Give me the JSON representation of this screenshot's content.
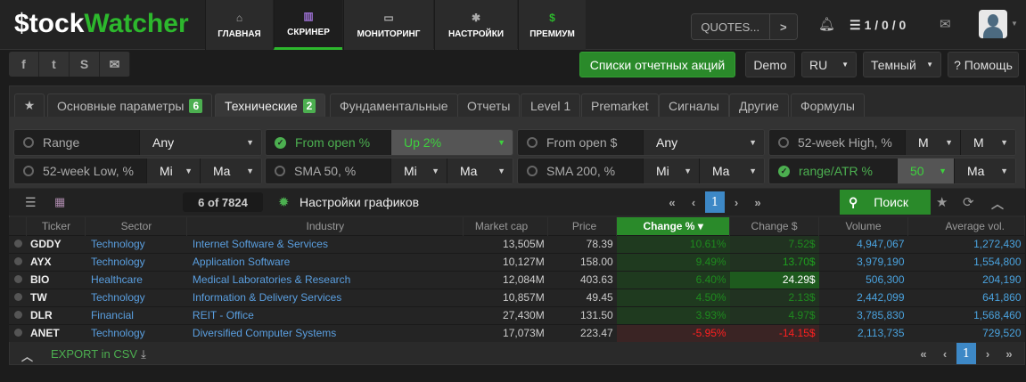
{
  "header": {
    "logo_dollar": "$",
    "logo_stock": "tock",
    "logo_watcher": "Watcher",
    "nav": [
      {
        "label": "ГЛАВНАЯ",
        "icon": "home-icon"
      },
      {
        "label": "СКРИНЕР",
        "icon": "bar-chart-icon",
        "active": true
      },
      {
        "label": "МОНИТОРИНГ",
        "icon": "monitor-icon"
      },
      {
        "label": "НАСТРОЙКИ",
        "icon": "gear-icon"
      },
      {
        "label": "ПРЕМИУМ",
        "icon": "dollar-icon"
      }
    ],
    "quotes_label": "QUOTES...",
    "counts": "1 / 0 / 0"
  },
  "toolbar": {
    "reports_button": "Списки отчетных акций",
    "demo_button": "Demo",
    "language": "RU",
    "theme": "Темный",
    "help_button": "? Помощь"
  },
  "tabs": [
    {
      "label": "Основные параметры",
      "badge": "6"
    },
    {
      "label": "Технические",
      "badge": "2",
      "active": true
    },
    {
      "label": "Фундаментальные"
    },
    {
      "label": "Отчеты"
    },
    {
      "label": "Level 1"
    },
    {
      "label": "Premarket"
    },
    {
      "label": "Сигналы"
    },
    {
      "label": "Другие"
    },
    {
      "label": "Формулы"
    }
  ],
  "filters": [
    {
      "label": "Range",
      "value": "Any"
    },
    {
      "label": "From open %",
      "value": "Up 2%",
      "active": true
    },
    {
      "label": "From open $",
      "value": "Any"
    },
    {
      "label": "52-week High, %",
      "min": "M",
      "max": "M"
    },
    {
      "label": "52-week Low, %",
      "min": "Mi",
      "max": "Ma"
    },
    {
      "label": "SMA 50, %",
      "min": "Mi",
      "max": "Ma"
    },
    {
      "label": "SMA 200, %",
      "min": "Mi",
      "max": "Ma"
    },
    {
      "label": "range/ATR %",
      "min": "50",
      "max": "Ma",
      "active": true
    }
  ],
  "results": {
    "count": "6 of 7824",
    "chart_settings": "Настройки графиков",
    "page": "1",
    "search_button": "Поиск"
  },
  "table": {
    "columns": [
      "Ticker",
      "Sector",
      "Industry",
      "Market cap",
      "Price",
      "Change %",
      "Change $",
      "Volume",
      "Average vol."
    ],
    "rows": [
      [
        "GDDY",
        "Technology",
        "Internet Software & Services",
        "13,505M",
        "78.39",
        "10.61%",
        "7.52$",
        "4,947,067",
        "1,272,430"
      ],
      [
        "AYX",
        "Technology",
        "Application Software",
        "10,127M",
        "158.00",
        "9.49%",
        "13.70$",
        "3,979,190",
        "1,554,800"
      ],
      [
        "BIO",
        "Healthcare",
        "Medical Laboratories & Research",
        "12,084M",
        "403.63",
        "6.40%",
        "24.29$",
        "506,300",
        "204,190"
      ],
      [
        "TW",
        "Technology",
        "Information & Delivery Services",
        "10,857M",
        "49.45",
        "4.50%",
        "2.13$",
        "2,442,099",
        "641,860"
      ],
      [
        "DLR",
        "Financial",
        "REIT - Office",
        "27,430M",
        "131.50",
        "3.93%",
        "4.97$",
        "3,785,830",
        "1,568,460"
      ],
      [
        "ANET",
        "Technology",
        "Diversified Computer Systems",
        "17,073M",
        "223.47",
        "-5.95%",
        "-14.15$",
        "2,113,735",
        "729,520"
      ]
    ]
  },
  "footer": {
    "export": "EXPORT in CSV",
    "page": "1"
  },
  "colors": {
    "accent": "#2db82d",
    "link": "#4aa3df",
    "negative": "#ff2020"
  }
}
